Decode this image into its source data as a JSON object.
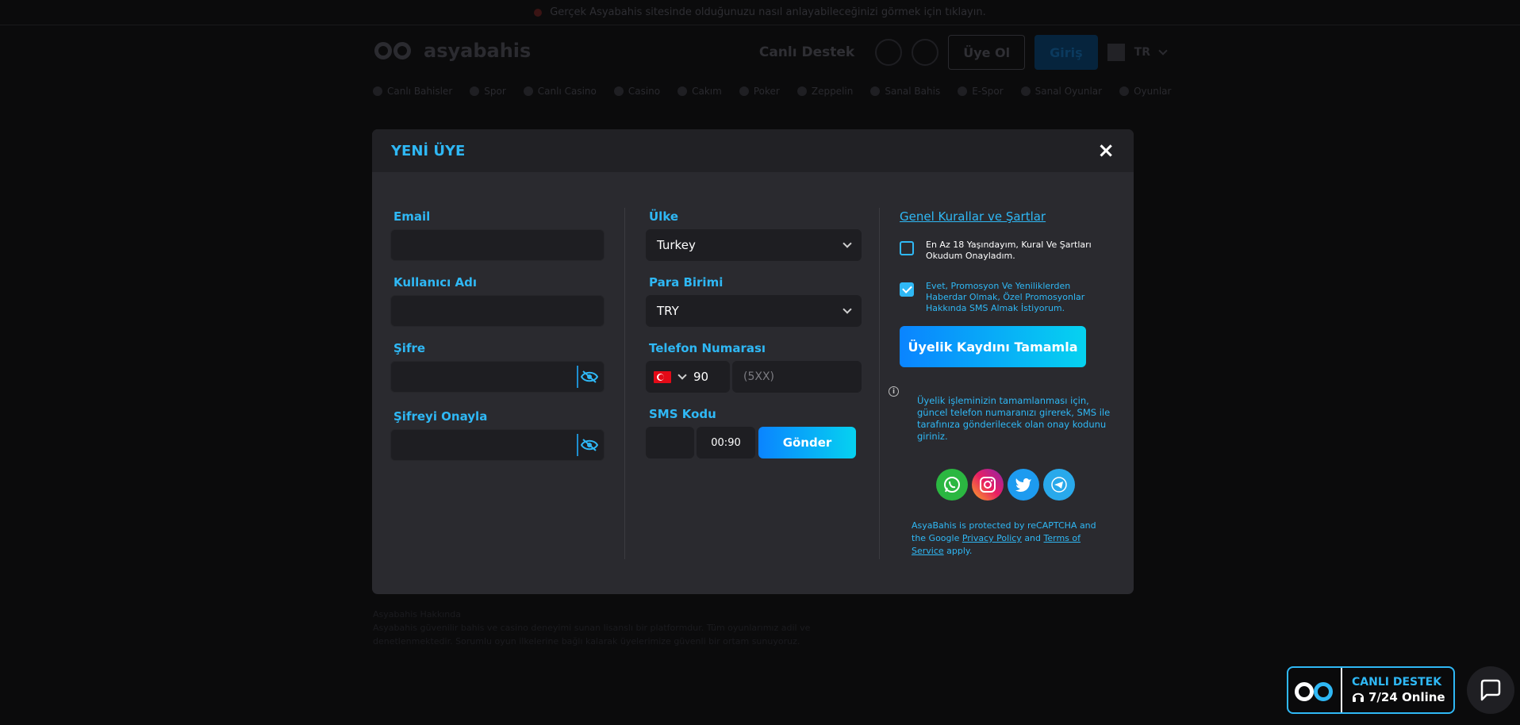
{
  "background": {
    "topbar_text": "Gerçek Asyabahis sitesinde olduğunuzu nasıl anlayabileceğinizi görmek için tıklayın.",
    "logo_text": "asyabahis",
    "live_support": "Canlı Destek",
    "register": "Üye Ol",
    "login": "Giriş",
    "lang": "TR",
    "nav": [
      "Canlı Bahisler",
      "Spor",
      "Canlı Casino",
      "Casino",
      "Cakım",
      "Poker",
      "Zeppelin",
      "Sanal Bahis",
      "E-Spor",
      "Sanal Oyunlar",
      "Oyunlar"
    ],
    "footer_title": "Asyabahis Hakkında",
    "footer_body": "Asyabahis güvenilir bahis ve casino deneyimi sunan lisanslı bir platformdur. Tüm oyunlarımız adil ve denetlenmektedir. Sorumlu oyun ilkelerine bağlı kalarak üyelerimize güvenli bir ortam sunuyoruz."
  },
  "modal": {
    "title": "YENİ ÜYE",
    "close_label": "×",
    "col1": {
      "email_label": "Email",
      "username_label": "Kullanıcı Adı",
      "password_label": "Şifre",
      "confirm_label": "Şifreyi Onayla"
    },
    "col2": {
      "country_label": "Ülke",
      "country_value": "Turkey",
      "currency_label": "Para Birimi",
      "currency_value": "TRY",
      "phone_label": "Telefon Numarası",
      "phone_code": "90",
      "phone_placeholder": "(5XX)",
      "sms_label": "SMS Kodu",
      "timer": "00:90",
      "send_label": "Gönder"
    },
    "col3": {
      "terms_link": "Genel Kurallar ve Şartlar",
      "check1_text": "En Az 18 Yaşındayım, Kural Ve Şartları Okudum Onayladım.",
      "check1_checked": false,
      "check2_text": "Evet, Promosyon Ve Yeniliklerden Haberdar Olmak, Özel Promosyonlar Hakkında SMS Almak İstiyorum.",
      "check2_checked": true,
      "complete_label": "Üyelik Kaydını Tamamla",
      "info_text": "Üyelik işleminizin tamamlanması için, güncel telefon numaranızı girerek, SMS ile tarafınıza gönderilecek olan onay kodunu giriniz.",
      "social": [
        "whatsapp-icon",
        "instagram-icon",
        "twitter-icon",
        "telegram-icon"
      ],
      "recaptcha_pre": "AsyaBahis is protected by reCAPTCHA and the Google",
      "privacy": "Privacy Policy",
      "and": "and",
      "terms_service": "Terms of Service",
      "apply": "apply."
    }
  },
  "widgets": {
    "live_title": "CANLI DESTEK",
    "live_sub": "7/24 Online"
  },
  "colors": {
    "accent": "#2fb8f5",
    "modal_bg": "#2a2a2f",
    "modal_header": "#212125",
    "input_bg": "#1e1e22",
    "button_from": "#0a84ff",
    "button_to": "#06d2f0"
  }
}
